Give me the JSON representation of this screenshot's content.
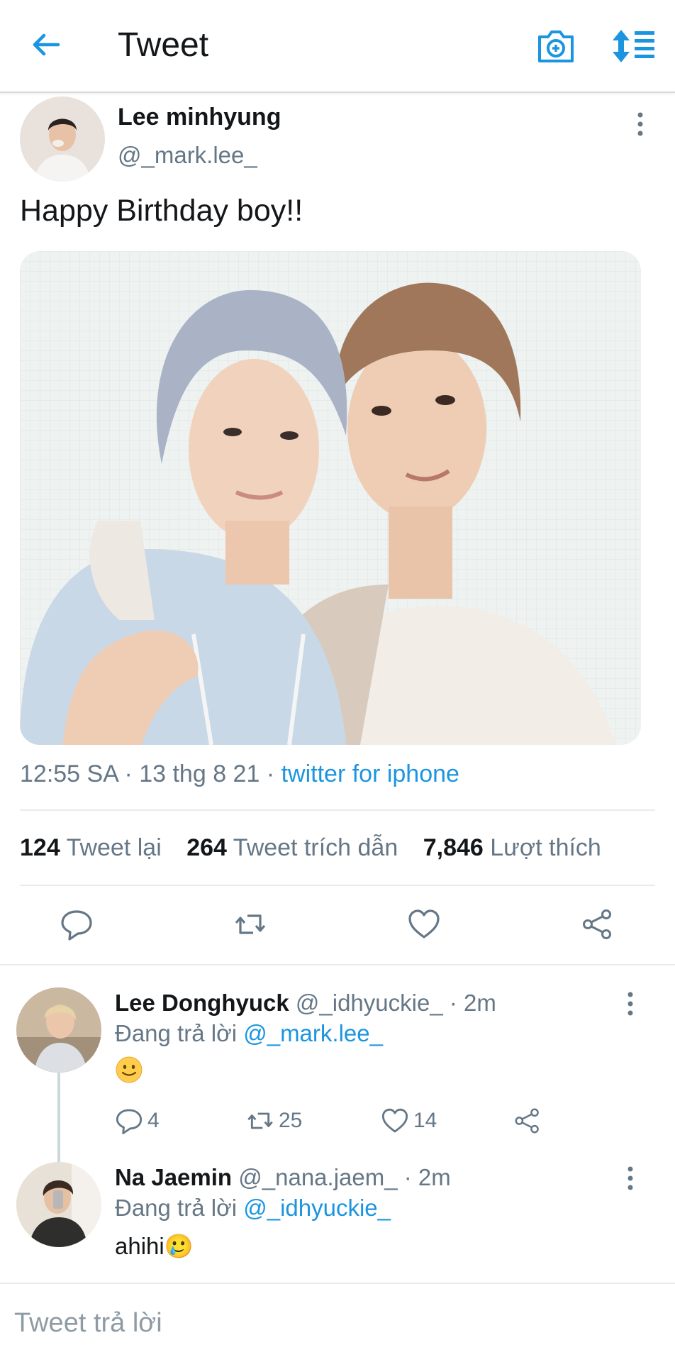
{
  "header": {
    "title": "Tweet",
    "icons": [
      "back-arrow-icon",
      "camera-icon",
      "sort-icon"
    ]
  },
  "tweet": {
    "author_name": "Lee minhyung",
    "author_handle": "@_mark.lee_",
    "text": "Happy Birthday boy!!",
    "time": "12:55 SA · 13 thg 8 21 · ",
    "source": "twitter for iphone",
    "stats": {
      "retweets_count": "124",
      "retweets_label": "Tweet lại",
      "quotes_count": "264",
      "quotes_label": "Tweet trích dẫn",
      "likes_count": "7,846",
      "likes_label": "Lượt thích"
    }
  },
  "replies": [
    {
      "name": "Lee Donghyuck",
      "handle_time": " @_idhyuckie_ · 2m",
      "replying_prefix": "Đang trả lời ",
      "replying_to": "@_mark.lee_",
      "body": "🙂",
      "reply_count": "4",
      "retweet_count": "25",
      "like_count": "14"
    },
    {
      "name": "Na Jaemin",
      "handle_time": " @_nana.jaem_ · 2m",
      "replying_prefix": "Đang trả lời ",
      "replying_to": "@_idhyuckie_",
      "body": "ahihi🥲"
    }
  ],
  "compose": {
    "placeholder": "Tweet trả lời"
  },
  "colors": {
    "accent": "#1b95e0",
    "muted": "#657786",
    "text": "#14171a"
  }
}
